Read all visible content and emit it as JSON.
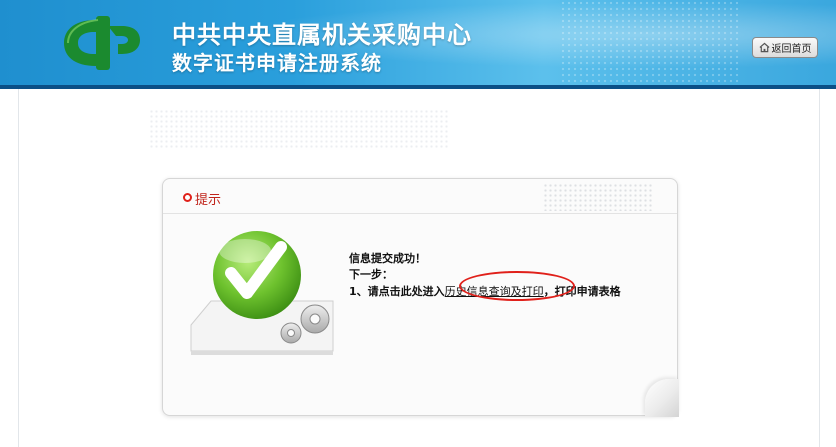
{
  "header": {
    "title": "中共中央直属机关采购中心",
    "subtitle": "数字证书申请注册系统",
    "home_label": "返回首页"
  },
  "dialog": {
    "label": "提示",
    "success_text": "信息提交成功！",
    "next_step": "下一步：",
    "step1_prefix": "1、请点击此处进入",
    "step1_link": "历史信息查询及打印",
    "step1_suffix": "，打印申请表格"
  },
  "colors": {
    "header_blue": "#2a9fdc",
    "accent_red": "#e0211a",
    "check_green": "#6ec22e"
  }
}
